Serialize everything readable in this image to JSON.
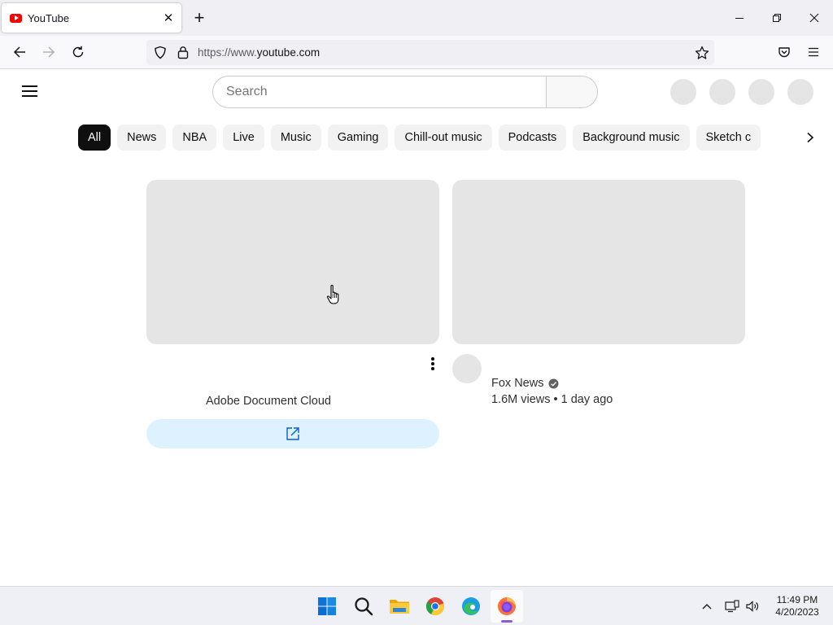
{
  "browser": {
    "tab_title": "YouTube",
    "new_tab_label": "+",
    "url_prefix": "https://www.",
    "url_host": "youtube.com"
  },
  "youtube": {
    "search_placeholder": "Search",
    "chips": [
      "All",
      "News",
      "NBA",
      "Live",
      "Music",
      "Gaming",
      "Chill-out music",
      "Podcasts",
      "Background music",
      "Sketch c"
    ],
    "active_chip": "All",
    "ad": {
      "advertiser": "Adobe Document Cloud"
    },
    "video2": {
      "channel": "Fox News",
      "verified": true,
      "meta": "1.6M views • 1 day ago"
    }
  },
  "taskbar": {
    "time": "11:49 PM",
    "date": "4/20/2023",
    "apps": [
      "start-icon",
      "search-icon",
      "file-explorer-icon",
      "chrome-icon",
      "edge-icon",
      "firefox-icon"
    ]
  },
  "colors": {
    "youtube_red": "#ff0000",
    "chip_active_bg": "#0f0f0f",
    "ad_button_bg": "#def1ff",
    "placeholder_gray": "#e5e5e5"
  }
}
